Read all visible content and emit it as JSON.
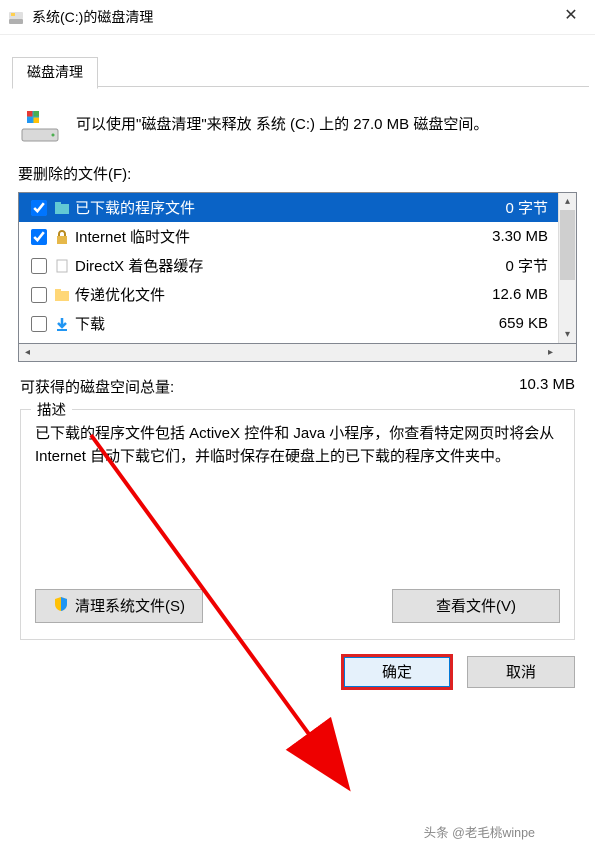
{
  "window": {
    "title": "系统(C:)的磁盘清理",
    "close": "✕"
  },
  "tab": {
    "label": "磁盘清理"
  },
  "summary": "可以使用\"磁盘清理\"来释放 系统 (C:) 上的 27.0 MB 磁盘空间。",
  "files_label": "要删除的文件(F):",
  "files": [
    {
      "checked": true,
      "icon": "folder-icon",
      "name": "已下载的程序文件",
      "size": "0 字节",
      "selected": true
    },
    {
      "checked": true,
      "icon": "lock-icon",
      "name": "Internet 临时文件",
      "size": "3.30 MB",
      "selected": false
    },
    {
      "checked": false,
      "icon": "file-icon",
      "name": "DirectX 着色器缓存",
      "size": "0 字节",
      "selected": false
    },
    {
      "checked": false,
      "icon": "folder2-icon",
      "name": "传递优化文件",
      "size": "12.6 MB",
      "selected": false
    },
    {
      "checked": false,
      "icon": "download-icon",
      "name": "下载",
      "size": "659 KB",
      "selected": false
    }
  ],
  "total": {
    "label": "可获得的磁盘空间总量:",
    "value": "10.3 MB"
  },
  "description": {
    "legend": "描述",
    "text": "已下载的程序文件包括 ActiveX 控件和 Java 小程序，你查看特定网页时将会从 Internet 自动下载它们，并临时保存在硬盘上的已下载的程序文件夹中。"
  },
  "buttons": {
    "clean_system": "清理系统文件(S)",
    "view_files": "查看文件(V)",
    "ok": "确定",
    "cancel": "取消"
  },
  "watermark": "头条 @老毛桃winpe"
}
